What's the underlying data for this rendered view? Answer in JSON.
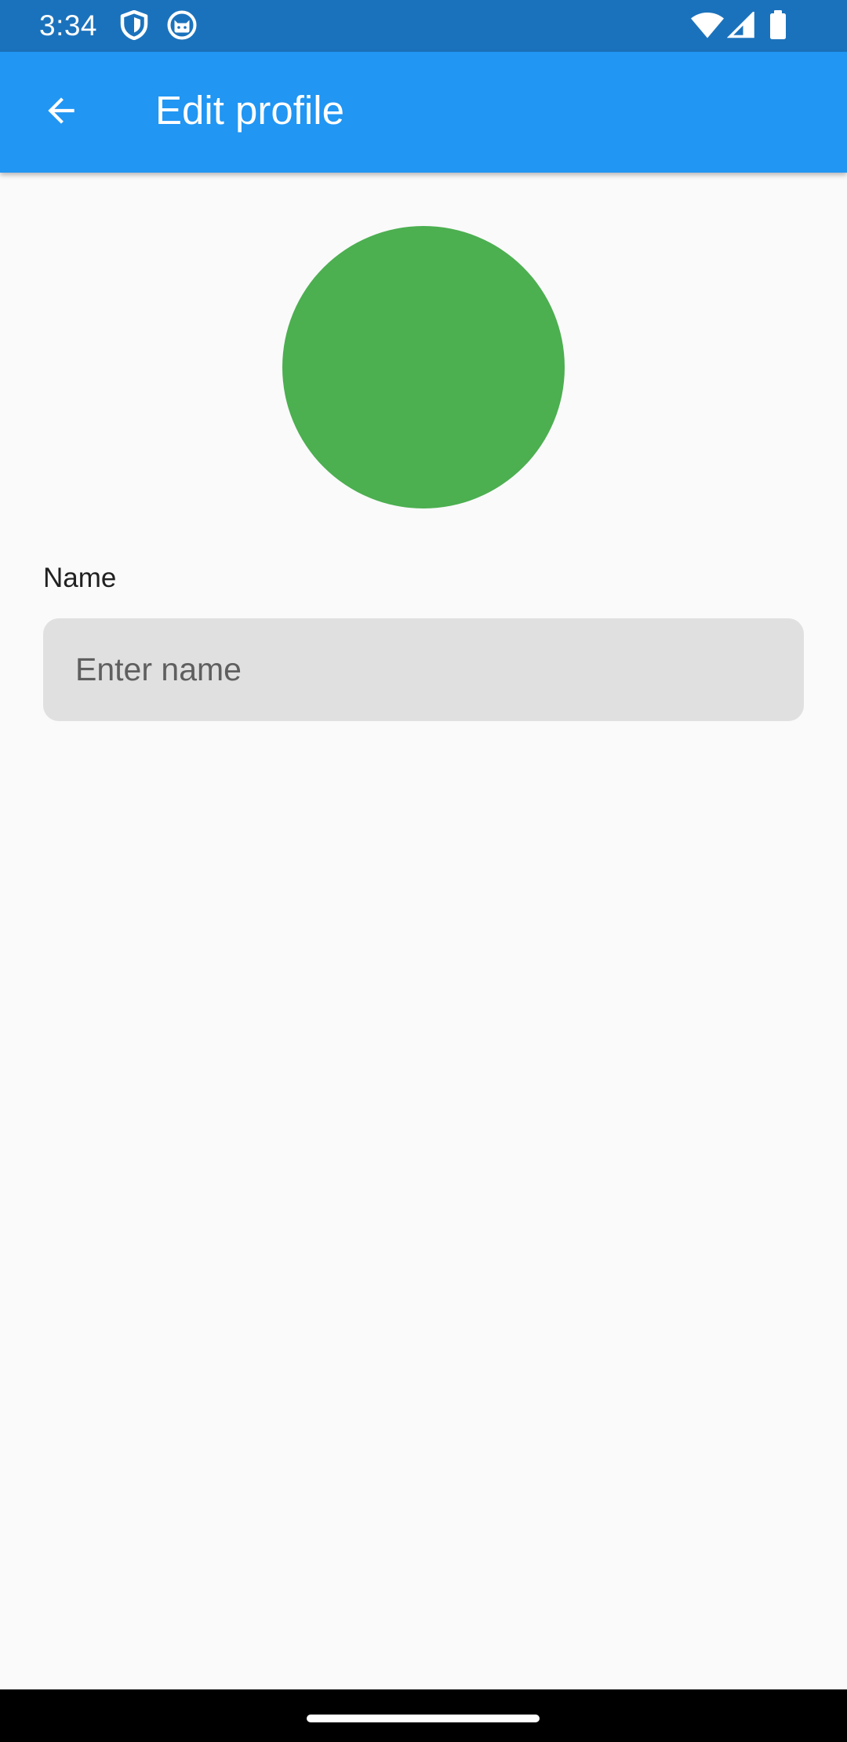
{
  "status_bar": {
    "time": "3:34",
    "background_color": "#1b72bc",
    "left_icons": [
      "shield-icon",
      "cat-face-icon"
    ],
    "right_icons": [
      "wifi-icon",
      "cellular-signal-icon",
      "battery-icon"
    ]
  },
  "app_bar": {
    "title": "Edit profile",
    "back_icon": "arrow-back-icon",
    "background_color": "#2196f3"
  },
  "avatar": {
    "color": "#4caf50"
  },
  "form": {
    "name_label": "Name",
    "name_value": "",
    "name_placeholder": "Enter name",
    "field_background_color": "#e0e0e0"
  },
  "navigation_bar": {
    "home_indicator_icon": "home-indicator"
  }
}
